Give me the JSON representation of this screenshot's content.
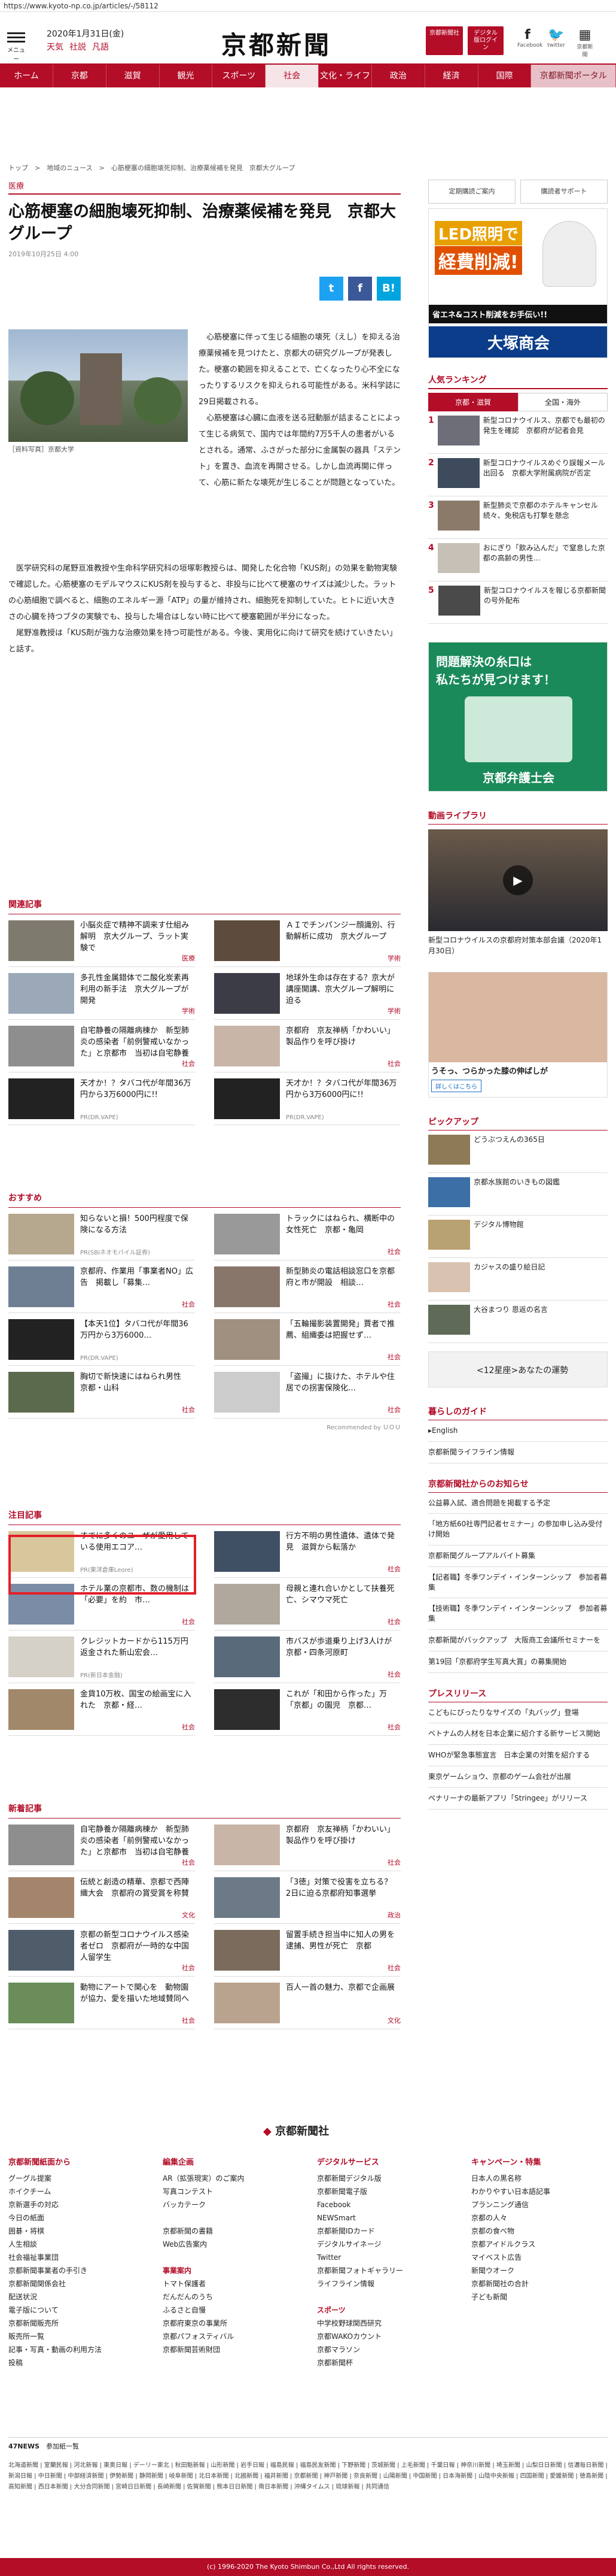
{
  "url": "https://www.kyoto-np.co.jp/articles/-/58112",
  "header": {
    "menu": "メニュー",
    "date": "2020年1月31日(金)",
    "links": [
      "天気",
      "社説",
      "凡語"
    ],
    "logo": "京都新聞",
    "btn_login": "京都新聞社",
    "btn_digital": "デジタル版ログイン",
    "social": [
      "Facebook",
      "twitter",
      "京都新聞"
    ]
  },
  "nav": [
    "ホーム",
    "京都",
    "滋賀",
    "観光",
    "スポーツ",
    "社会",
    "文化・ライフ",
    "政治",
    "経済",
    "国際",
    "京都新聞ポータル"
  ],
  "breadcrumb": "トップ　>　地域のニュース　>　心筋梗塞の細胞壊死抑制、治療薬候補を発見　京都大グループ",
  "article": {
    "category": "医療",
    "title": "心筋梗塞の細胞壊死抑制、治療薬候補を発見　京都大グループ",
    "date": "2019年10月25日 4:00",
    "caption": "［資料写真］京都大学",
    "p1": "心筋梗塞に伴って生じる細胞の壊死（えし）を抑える治療薬候補を見つけたと、京都大の研究グループが発表した。梗塞の範囲を抑えることで、亡くなったり心不全になったりするリスクを抑えられる可能性がある。米科学誌に29日掲載される。",
    "p2": "心筋梗塞は心臓に血液を送る冠動脈が詰まることによって生じる病気で、国内では年間約7万5千人の患者がいるとされる。通常、ふさがった部分に金属製の器具「ステント」を置き、血流を再開させる。しかし血流再開に伴って、心筋に新たな壊死が生じることが問題となっていた。",
    "p3": "医学研究科の尾野亘准教授や生命科学研究科の垣塚彰教授らは、開発した化合物「KUS剤」の効果を動物実験で確認した。心筋梗塞のモデルマウスにKUS剤を投与すると、非投与に比べて梗塞のサイズは減少した。ラットの心筋細胞で調べると、細胞のエネルギー源「ATP」の量が維持され、細胞死を抑制していた。ヒトに近い大きさの心臓を持つブタの実験でも、投与した場合はしない時に比べて梗塞範囲が半分になった。",
    "p4": "尾野准教授は「KUS剤が強力な治療効果を持つ可能性がある。今後、実用化に向けて研究を続けていきたい」と話す。"
  },
  "share": [
    "t",
    "f",
    "B!"
  ],
  "related": {
    "heading": "関連記事",
    "items": [
      {
        "t": "小脳炎症で精神不調来す仕組み解明　京大グループ、ラット実験で",
        "p": "医療"
      },
      {
        "t": "ＡＩでチンパンジー顔識別、行動解析に成功　京大グループ",
        "p": "学術"
      },
      {
        "t": "多孔性金属錯体で二酸化炭素再利用の新手法　京大グループが開発",
        "p": "学術"
      },
      {
        "t": "地球外生命は存在する？京大が講座開講、京大グループ解明に迫る",
        "p": "学術"
      },
      {
        "t": "自宅静養の隔離病棟か　新型肺炎の感染者「前例警戒いなかった」と京都市　当初は自宅静養",
        "p": "社会"
      },
      {
        "t": "京都府　京友禅柄「かわいい」製品作りを呼び掛け",
        "p": "社会"
      },
      {
        "t": "天才か！？タバコ代が年間36万円から3万6000円に!!",
        "p": "PR(DR.VAPE)"
      },
      {
        "t": "天才か！？タバコ代が年間36万円から3万6000円に!!",
        "p": "PR(DR.VAPE)"
      }
    ]
  },
  "recommend": {
    "heading": "おすすめ",
    "items": [
      {
        "t": "知らないと損！500円程度で保険になる方法",
        "p": "PR(SBIネオモバイル証券)"
      },
      {
        "t": "トラックにはねられ、横断中の女性死亡　京都・亀岡",
        "p": "社会"
      },
      {
        "t": "京都府、作業用「事業者NO」広告　掲載し「募集…",
        "p": "社会"
      },
      {
        "t": "新型肺炎の電話相談窓口を京都府と市が開設　相談…",
        "p": "社会"
      },
      {
        "t": "【本天1位】タバコ代が年間36万円から3万6000…",
        "p": "PR(DR.VAPE)"
      },
      {
        "t": "「五輪撮影装置開発」賈者で推薦、組織委は把握せず…",
        "p": "社会"
      },
      {
        "t": "胸切で新快速にはねられ男性　京都・山科",
        "p": "社会"
      },
      {
        "t": "「盗撮」に抜けた、ホテルや住居での拐害保険化…",
        "p": "社会"
      }
    ],
    "by": "Recommended by ＵＯＵ"
  },
  "notable": {
    "heading": "注目記事",
    "items": [
      {
        "t": "すでに多くのユーザが愛用している使用エコア…",
        "p": "PR(東洋倉庫Leore)"
      },
      {
        "t": "行方不明の男性遺体、遺体で発見　滋賀から転落か",
        "p": "社会"
      },
      {
        "t": "ホテル業の京都市、数の機制は「必要」を約　市…",
        "p": "社会"
      },
      {
        "t": "母親と連れ合いかとして扶養死亡、シマウマ死亡",
        "p": "社会"
      },
      {
        "t": "クレジットカードから115万円返金された新山宏会…",
        "p": "PR(新日本金融)"
      },
      {
        "t": "市バスが歩道乗り上げ3人けが　京都・四条河原町",
        "p": "社会"
      },
      {
        "t": "金貨10万枚、国宝の絵画宝に入れた　京都・経…",
        "p": "社会"
      },
      {
        "t": "これが「和田から作った」万「京都」の園児　京都…",
        "p": "社会"
      }
    ]
  },
  "latest": {
    "heading": "新着記事",
    "items": [
      {
        "t": "自宅静養か隔離病棟か　新型肺炎の感染者「前例警戒いなかった」と京都市　当初は自宅静養",
        "p": "社会"
      },
      {
        "t": "京都府　京友禅柄「かわいい」製品作りを呼び掛け",
        "p": "社会"
      },
      {
        "t": "伝統と創造の精華、京都で西陣織大会　京都府の賞受賞を称賛",
        "p": "文化"
      },
      {
        "t": "「3徳」対策で役害を立ちる？　2日に迫る京都府知事選挙",
        "p": "政治"
      },
      {
        "t": "京都の新型コロナウイルス感染者ゼロ　京都府が一時的な中国人留学生",
        "p": "社会"
      },
      {
        "t": "留置手続き担当中に知人の男を逮捕、男性が死亡　京都",
        "p": "社会"
      },
      {
        "t": "動物にアートで関心を　動物園が協力、愛を描いた地域賛同へ",
        "p": "社会"
      },
      {
        "t": "百人一首の魅力、京都で企画展",
        "p": "文化"
      }
    ]
  },
  "sidebar": {
    "top_links": [
      "定期購読ご案内",
      "購読者サポート"
    ],
    "ad1": {
      "l1": "LED照明で",
      "l2": "経費削減!",
      "l3": "省エネ&コスト削減をお手伝い!!",
      "l4": "大塚商会"
    },
    "ranking": {
      "heading": "人気ランキング",
      "tabs": [
        "京都・滋賀",
        "全国・海外"
      ],
      "items": [
        "新型コロナウイルス、京都でも最初の発生を確認　京都府が記者会見",
        "新型コロナウイルスめぐり誤報メール出回る　京都大学附属病院が否定",
        "新型肺炎で京都のホテルキャンセル続々、免税店も打撃を懸念",
        "おにぎり「飲み込んだ」で窒息した京都の高齢の男性…",
        "新型コロナウイルスを報じる京都新聞の号外配布"
      ]
    },
    "ad2": {
      "l1": "問題解決の糸口は",
      "l2": "私たちが見つけます！",
      "l3": "京都弁護士会"
    },
    "video": {
      "heading": "動画ライブラリ",
      "caption": "新型コロナウイルスの京都府対策本部会議（2020年1月30日）"
    },
    "ad3": {
      "t": "うそっ、つらかった膝の伸ばしが",
      "btn": "詳しくはこちら"
    },
    "pickup": {
      "heading": "ピックアップ",
      "items": [
        "どうぶつえんの365日",
        "京都水族館のいきもの図鑑",
        "デジタル博物館",
        "カジャスの盛り絵日記",
        "大谷まつり 恩返の名言"
      ]
    },
    "ad4": {
      "t": "<12星座>あなたの運勢"
    },
    "living": {
      "heading": "暮らしのガイド",
      "items": [
        "▸English",
        "京都新聞ライフライン情報"
      ]
    },
    "notice": {
      "heading": "京都新聞社からのお知らせ",
      "items": [
        "公益募入試、適合問題を掲載する予定",
        "「地方紙60社専門記者セミナー」の参加申し込み受付け開始",
        "京都新聞グループアルバイト募集",
        "【記者職】冬季ワンデイ・インターンシップ　参加者募集",
        "【技術職】冬季ワンデイ・インターンシップ　参加者募集",
        "京都新聞がバックアップ　大阪商工会議所セミナーを",
        "第19回「京都府学生写真大賞」の募集開始"
      ]
    },
    "press": {
      "heading": "プレスリリース",
      "items": [
        "こどもにぴったりなサイズの「丸バッグ」登場",
        "ベトナムの人材を日本企業に紹介する新サービス開始",
        "WHOが緊急事態宣言　日本企業の対策を紹介する",
        "東京ゲームショウ、京都のゲーム会社が出展",
        "ペナリーナの最新アプリ「Stringee」がリリース"
      ]
    }
  },
  "footer": {
    "logo": "京都新聞社",
    "cols": [
      {
        "h": "京都新聞紙面から",
        "items": [
          "グーグル提案",
          "ホイクチーム",
          "京新選手の対応",
          "今日の紙面",
          "囲碁・将棋",
          "人生相談",
          "社会福祉事業団",
          "京都新聞事業者の手引き",
          "京都新聞関係会社",
          "配送状況",
          "電子版について",
          "京都新聞販売所",
          "販売所一覧",
          "記事・写真・動画の利用方法",
          "投稿"
        ]
      },
      {
        "h": "編集企画",
        "items": [
          "AR（拡張現実）のご案内",
          "写真コンテスト",
          "バッカテーク",
          "",
          "京都新聞の書籍",
          "Web広告案内",
          "",
          "事業案内",
          "トマト保護者",
          "だんだんのうち",
          "ふるさと自慢",
          "京都府東京の事業所",
          "京都パフォスティバル",
          "京都新聞芸術財団"
        ]
      },
      {
        "h": "デジタルサービス",
        "items": [
          "京都新聞デジタル版",
          "京都新聞電子版",
          "Facebook",
          "NEWSmart",
          "京都新聞IDカード",
          "デジタルサイネージ",
          "Twitter",
          "京都新聞フォトギャラリー",
          "ライフライン情報",
          "",
          "スポーツ",
          "中学校野球関西研究",
          "京都WAKOカウント",
          "京都マラソン",
          "京都新聞杯"
        ]
      },
      {
        "h": "キャンペーン・特集",
        "items": [
          "日本人の黒名称",
          "わかりやすい日本語記事",
          "プランニング通信",
          "京都の人々",
          "京都の食べ物",
          "京都アイドルクラス",
          "マイベスト広告",
          "新聞ウオーク",
          "京都新聞社の合計",
          "子ども新聞"
        ]
      }
    ]
  },
  "news47": {
    "label": "47NEWS",
    "sub": "参加紙一覧",
    "links": "北海道新聞 | 室蘭民報 | 河北新報 | 東奥日報 | デーリー東北 | 秋田魁新報 | 山形新聞 | 岩手日報 | 福島民報 | 福島民友新聞 | 下野新聞 | 茨城新聞 | 上毛新聞 | 千葉日報 | 神奈川新聞 | 埼玉新聞 | 山梨日日新聞 | 信濃毎日新聞 | 新潟日報 | 中日新聞 | 中部経済新聞 | 伊勢新聞 | 静岡新聞 | 岐阜新聞 | 北日本新聞 | 北國新聞 | 福井新聞 | 京都新聞 | 神戸新聞 | 奈良新聞 | 山陽新聞 | 中国新聞 | 日本海新聞 | 山陰中央新報 | 四国新聞 | 愛媛新聞 | 徳島新聞 | 高知新聞 | 西日本新聞 | 大分合同新聞 | 宮崎日日新聞 | 長崎新聞 | 佐賀新聞 | 熊本日日新聞 | 南日本新聞 | 沖縄タイムス | 琉球新報 | 共同通信"
  },
  "copyright": "(c) 1996-2020 The Kyoto Shimbun Co.,Ltd All rights reserved.",
  "colors": {
    "brand": "#b30d28"
  }
}
